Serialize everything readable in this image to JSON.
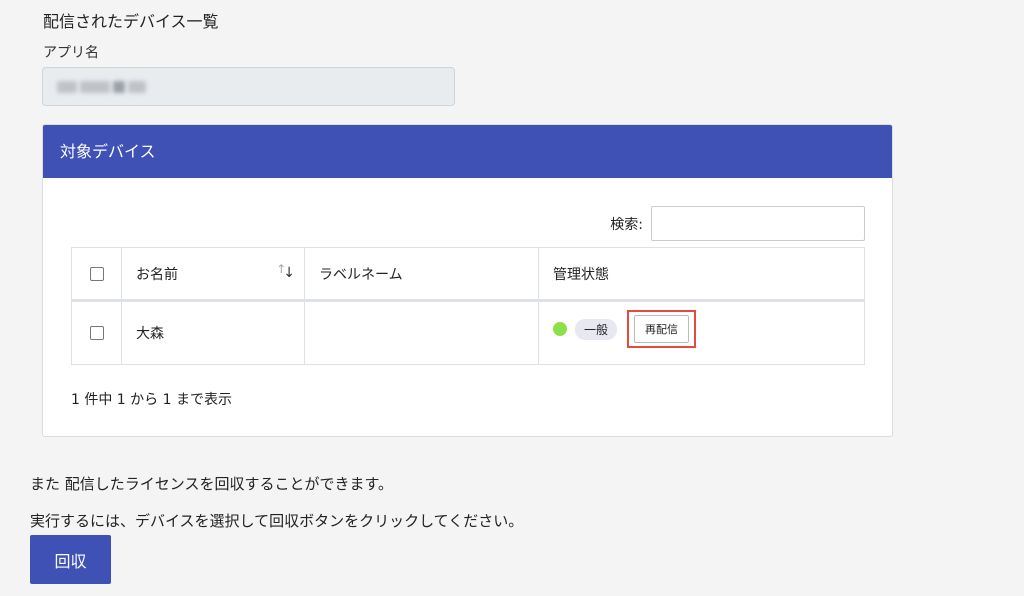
{
  "page": {
    "title": "配信されたデバイス一覧"
  },
  "app_name": {
    "label": "アプリ名",
    "value": ""
  },
  "devices_card": {
    "title": "対象デバイス",
    "search_label": "検索:",
    "search_value": "",
    "columns": [
      "お名前",
      "ラベルネーム",
      "管理状態"
    ],
    "rows": [
      {
        "name": "大森",
        "label_name": "",
        "status_color": "#8ee04a",
        "status_chip": "一般",
        "action": "再配信"
      }
    ],
    "count_text": "1 件中 1 から 1 まで表示"
  },
  "info": {
    "line1": "また 配信したライセンスを回収することができます。",
    "line2": "実行するには、デバイスを選択して回収ボタンをクリックしてください。"
  },
  "revoke_button": "回収",
  "colors": {
    "accent": "#3f51b5",
    "highlight": "#e34b3a"
  }
}
